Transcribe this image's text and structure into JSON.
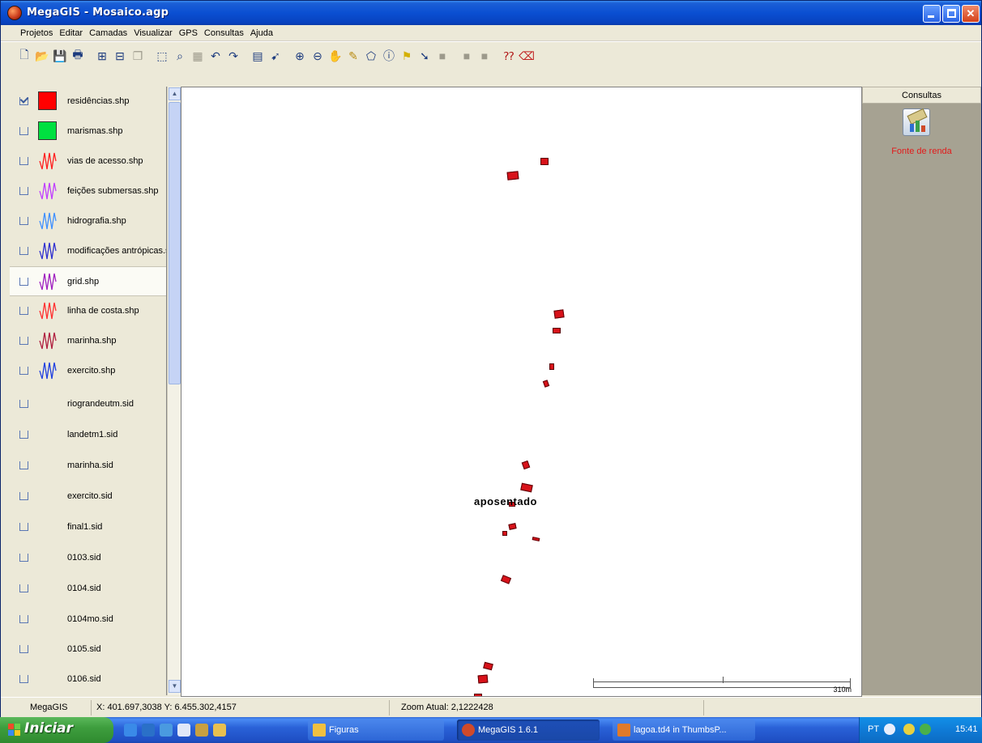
{
  "window": {
    "title": "MegaGIS - Mosaico.agp",
    "colors": {
      "titlebar": "#0a4fd2",
      "close": "#d4421a"
    }
  },
  "menu": [
    "Projetos",
    "Editar",
    "Camadas",
    "Visualizar",
    "GPS",
    "Consultas",
    "Ajuda"
  ],
  "toolbar": {
    "icons": [
      "new-icon",
      "open-icon",
      "save-icon",
      "print-icon",
      "add-layer-icon",
      "remove-layer-icon",
      "copy-icon",
      "select-icon",
      "zoom-select-icon",
      "table-icon",
      "undo-icon",
      "redo-icon",
      "window-icon",
      "pointer-icon",
      "zoom-in-icon",
      "zoom-out-icon",
      "pan-icon",
      "pencil-icon",
      "polygon-icon",
      "info-icon",
      "flag-icon",
      "arrow-icon",
      "square-icon",
      "square-icon",
      "square-icon",
      "help-icon",
      "eraser-icon"
    ]
  },
  "layers": [
    {
      "name": "residências.shp",
      "checked": true,
      "kind": "fill",
      "color": "#ff0000"
    },
    {
      "name": "marismas.shp",
      "checked": false,
      "kind": "fill",
      "color": "#00e040"
    },
    {
      "name": "vias de acesso.shp",
      "checked": false,
      "kind": "line",
      "color": "#ff2020"
    },
    {
      "name": "feições submersas.shp",
      "checked": false,
      "kind": "line",
      "color": "#c040ff"
    },
    {
      "name": "hidrografia.shp",
      "checked": false,
      "kind": "line",
      "color": "#4090ff"
    },
    {
      "name": "modificações antrópicas.shp",
      "checked": false,
      "kind": "line",
      "color": "#3030d0"
    },
    {
      "name": "grid.shp",
      "checked": false,
      "kind": "line",
      "color": "#a020c0"
    },
    {
      "name": "linha de costa.shp",
      "checked": false,
      "kind": "line",
      "color": "#ff3030"
    },
    {
      "name": "marinha.shp",
      "checked": false,
      "kind": "line",
      "color": "#b02040"
    },
    {
      "name": "exercito.shp",
      "checked": false,
      "kind": "line",
      "color": "#2040e0"
    },
    {
      "name": "riograndeutm.sid",
      "checked": false,
      "kind": "raster"
    },
    {
      "name": "landetm1.sid",
      "checked": false,
      "kind": "raster"
    },
    {
      "name": "marinha.sid",
      "checked": false,
      "kind": "raster"
    },
    {
      "name": "exercito.sid",
      "checked": false,
      "kind": "raster"
    },
    {
      "name": "final1.sid",
      "checked": false,
      "kind": "raster"
    },
    {
      "name": "0103.sid",
      "checked": false,
      "kind": "raster"
    },
    {
      "name": "0104.sid",
      "checked": false,
      "kind": "raster"
    },
    {
      "name": "0104mo.sid",
      "checked": false,
      "kind": "raster"
    },
    {
      "name": "0105.sid",
      "checked": false,
      "kind": "raster"
    },
    {
      "name": "0106.sid",
      "checked": false,
      "kind": "raster"
    }
  ],
  "map": {
    "label": "aposentado",
    "scale_label": "310m",
    "feature_color": "#d8121a"
  },
  "consultas": {
    "title": "Consultas",
    "query_label": "Fonte de renda",
    "label_color": "#e21b1b"
  },
  "status": {
    "app": "MegaGIS",
    "coords": "X: 401.697,3038 Y: 6.455.302,4157",
    "zoom": "Zoom Atual: 2,1222428"
  },
  "taskbar": {
    "start": "Iniciar",
    "tasks": [
      {
        "label": "Figuras",
        "active": false
      },
      {
        "label": "MegaGIS 1.6.1",
        "active": true
      },
      {
        "label": "lagoa.td4 in ThumbsP...",
        "active": false
      }
    ],
    "lang": "PT",
    "clock": "15:41"
  }
}
